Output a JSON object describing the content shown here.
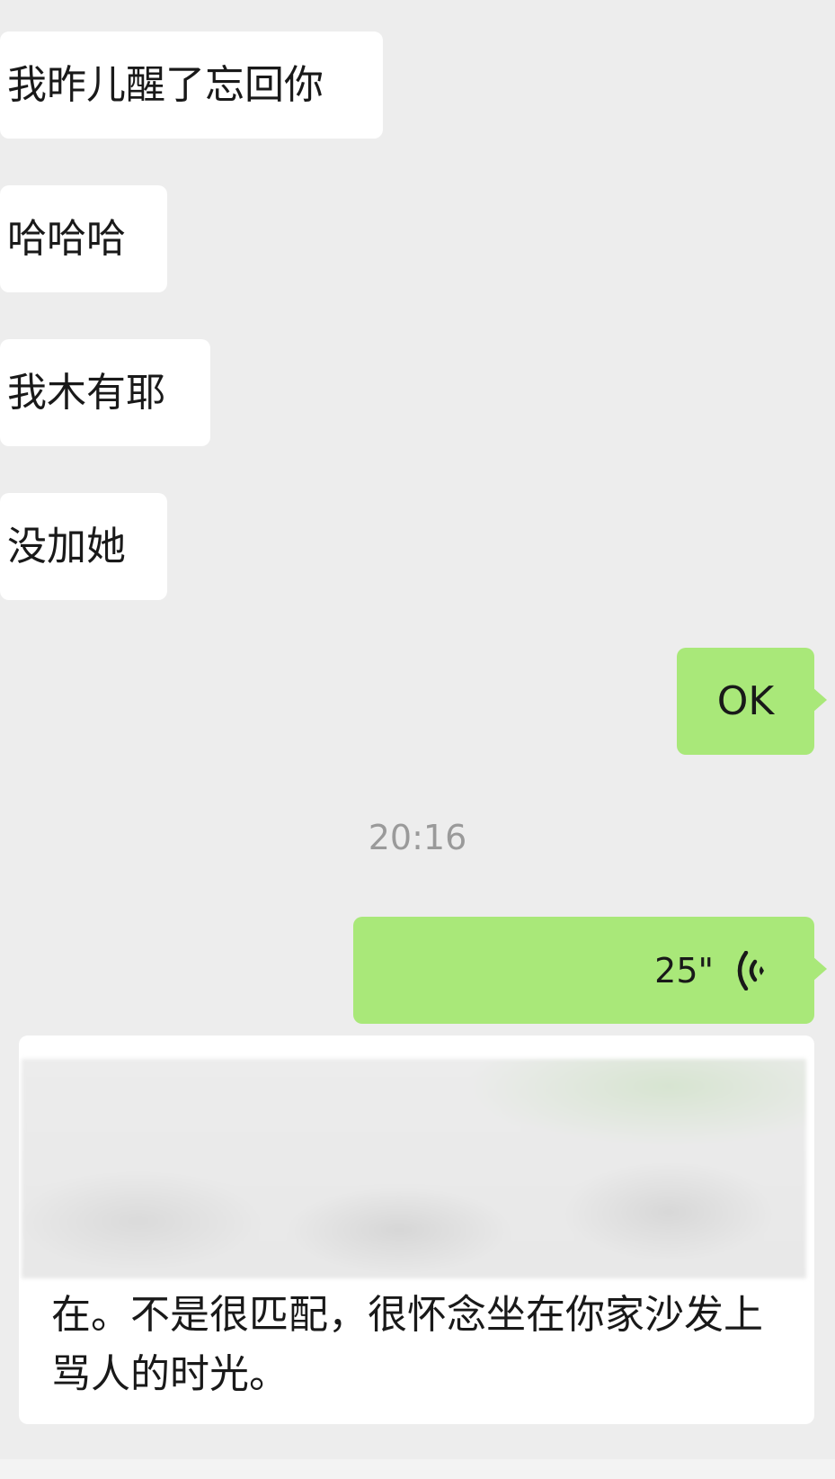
{
  "chat": {
    "incoming": [
      {
        "text": "我昨儿醒了忘回你"
      },
      {
        "text": "哈哈哈"
      },
      {
        "text": "我木有耶"
      },
      {
        "text": "没加她"
      }
    ],
    "outgoing_ok": {
      "text": "OK"
    },
    "timestamp": "20:16",
    "voice_message": {
      "duration": "25\"",
      "icon": "voice-wave-icon"
    },
    "card": {
      "image": "blurred-photo",
      "text": "在。不是很匹配，很怀念坐在你家沙发上骂人的时光。"
    }
  },
  "colors": {
    "background": "#ededed",
    "incoming_bubble": "#ffffff",
    "outgoing_bubble": "#a9e879",
    "timestamp": "#9a9a9a",
    "text": "#191919"
  }
}
